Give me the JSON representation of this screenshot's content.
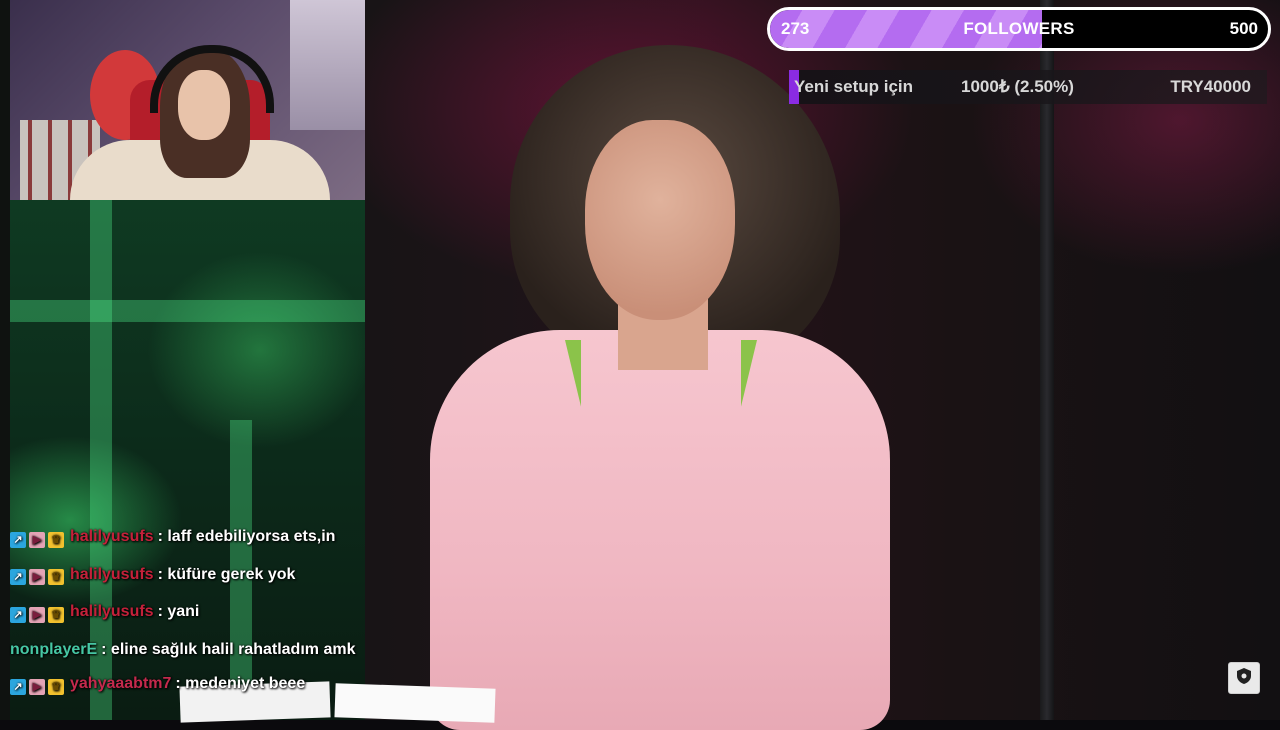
{
  "follower_goal": {
    "current": "273",
    "label": "FOLLOWERS",
    "target": "500",
    "progress_fraction": 0.546,
    "fill_color": "#b46cf0"
  },
  "donation_goal": {
    "title": "Yeni setup için",
    "progress_text": "1000₺ (2.50%)",
    "target": "TRY40000",
    "progress_fraction": 0.025,
    "fill_color": "#8a2be2"
  },
  "chat": {
    "messages": [
      {
        "badges": [
          "sub-badge",
          "vip-badge",
          "crown-badge"
        ],
        "username": "halilyusufs",
        "user_color": "#c4213a",
        "text": ": laff edebiliyorsa ets,in"
      },
      {
        "badges": [
          "sub-badge",
          "vip-badge",
          "crown-badge"
        ],
        "username": "halilyusufs",
        "user_color": "#c4213a",
        "text": ": küfüre gerek yok"
      },
      {
        "badges": [
          "sub-badge",
          "vip-badge",
          "crown-badge"
        ],
        "username": "halilyusufs",
        "user_color": "#c4213a",
        "text": ": yani"
      },
      {
        "badges": [],
        "username": "nonplayerE",
        "user_color": "#46c7a4",
        "text": ": eline sağlık halil rahatladım amk"
      },
      {
        "badges": [
          "sub-badge",
          "vip-badge",
          "crown-badge"
        ],
        "username": "yahyaaabtm7",
        "user_color": "#c42a4d",
        "text": ": medeniyet beee"
      }
    ]
  },
  "corner_button": {
    "icon": "shield-icon"
  }
}
